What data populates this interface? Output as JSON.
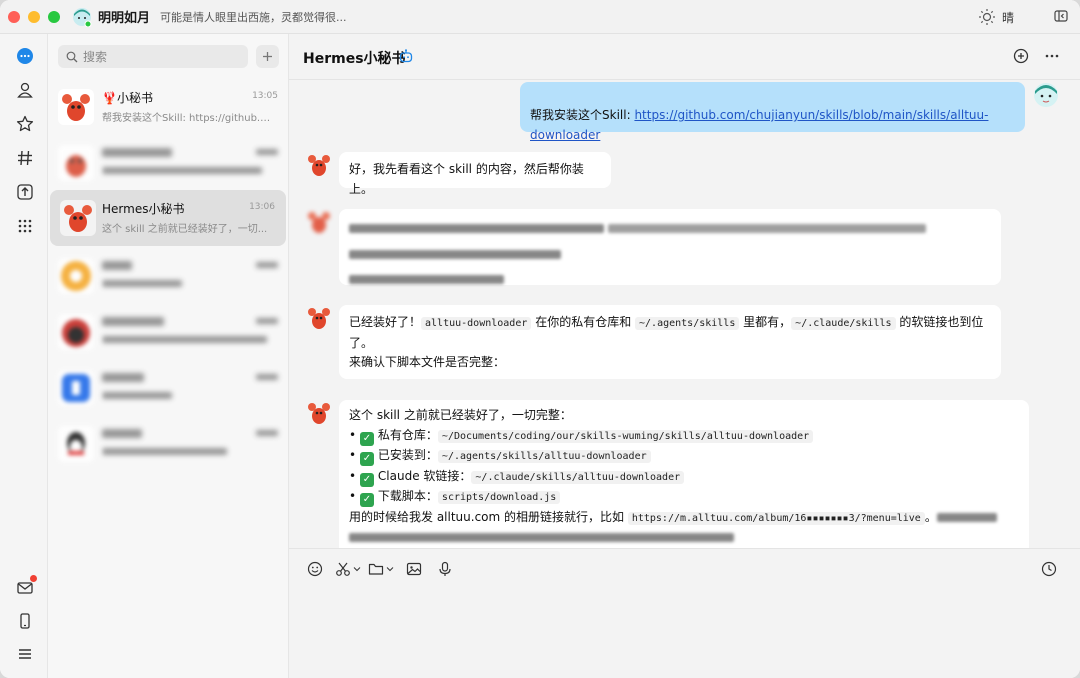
{
  "titlebar": {
    "user_name": "明明如月",
    "status_text": "可能是情人眼里出西施，灵都觉得很...",
    "weather": "晴"
  },
  "search": {
    "placeholder": "搜索"
  },
  "conversations": [
    {
      "name": "🦞小秘书",
      "time": "13:05",
      "preview": "帮我安装这个Skill: https://github.c...",
      "blurred": false
    },
    {
      "name": "...",
      "time": "...",
      "preview": "...",
      "blurred": true
    },
    {
      "name": "Hermes小秘书",
      "time": "13:06",
      "preview": "这个 skill 之前就已经装好了，一切...",
      "blurred": false,
      "active": true
    },
    {
      "name": "...",
      "time": "...",
      "preview": "...",
      "blurred": true
    },
    {
      "name": "...",
      "time": "...",
      "preview": "...",
      "blurred": true
    },
    {
      "name": "...",
      "time": "...",
      "preview": "...",
      "blurred": true
    },
    {
      "name": "...",
      "time": "...",
      "preview": "...",
      "blurred": true
    }
  ],
  "chat": {
    "title": "Hermes小秘书",
    "msg_user": {
      "prefix": "帮我安装这个Skill: ",
      "link": "https://github.com/chujianyun/skills/blob/main/skills/alltuu-downloader"
    },
    "msg_bot1": "好，我先看看这个 skill 的内容，然后帮你装上。",
    "msg_bot3": {
      "p1": "已经装好了！",
      "c1": "alltuu-downloader",
      "p2": " 在你的私有仓库和 ",
      "c2": "~/.agents/skills",
      "p3": " 里都有，",
      "c3": "~/.claude/skills",
      "p4": " 的软链接也到位了。",
      "line2": "来确认下脚本文件是否完整："
    },
    "msg_bot4": {
      "intro": "这个 skill 之前就已经装好了，一切完整：",
      "items": [
        {
          "label": "私有仓库：",
          "code": "~/Documents/coding/our/skills-wuming/skills/alltuu-downloader"
        },
        {
          "label": "已安装到：",
          "code": "~/.agents/skills/alltuu-downloader"
        },
        {
          "label": "Claude 软链接：",
          "code": "~/.claude/skills/alltuu-downloader"
        },
        {
          "label": "下载脚本：",
          "code": "scripts/download.js"
        }
      ],
      "outro": "用的时候给我发 alltuu.com 的相册链接就行，比如 ",
      "outro_code": "https://m.alltuu.com/album/16▪▪▪▪▪▪▪3/?menu=live",
      "outro_end": "。"
    }
  },
  "icons": {
    "rail": [
      "chat-bubble-icon",
      "contacts-icon",
      "favorites-icon",
      "channels-icon",
      "upload-icon",
      "apps-grid-icon",
      "mail-icon",
      "phone-icon",
      "menu-icon"
    ],
    "composer": [
      "emoji-icon",
      "scissors-icon",
      "folder-icon",
      "image-icon",
      "microphone-icon",
      "history-icon"
    ]
  },
  "colors": {
    "accent": "#1f87e8",
    "my_bubble": "#b5e0fb",
    "link": "#1f55c6"
  }
}
